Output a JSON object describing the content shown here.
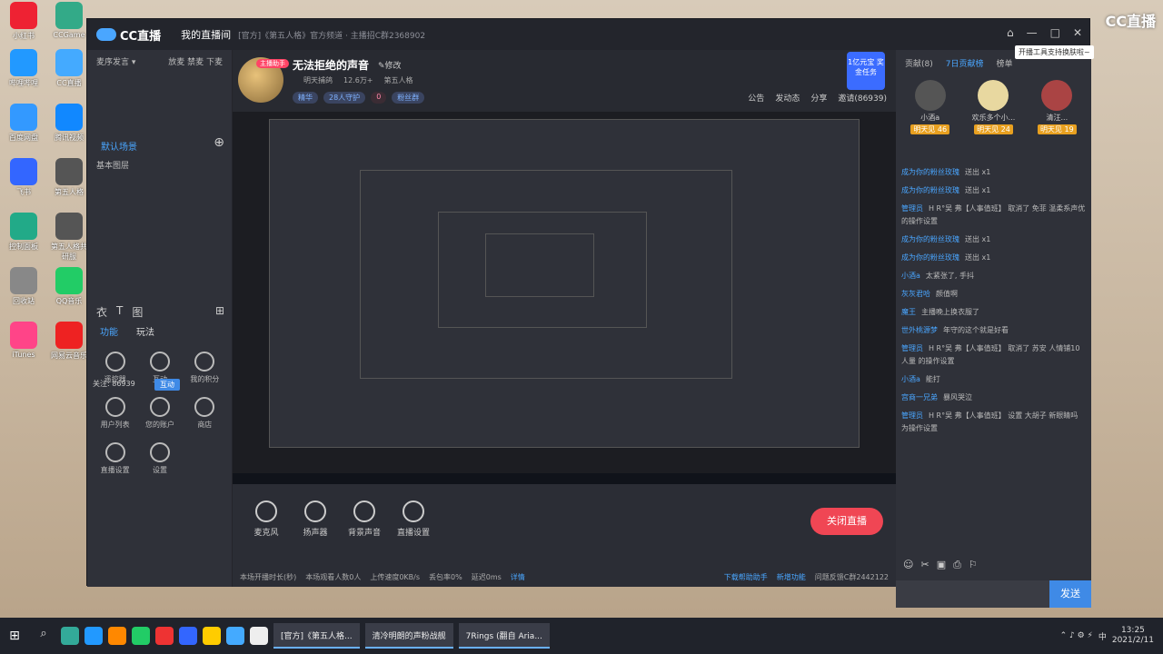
{
  "desktop_icons": [
    {
      "label": "小红书",
      "color": "#e23"
    },
    {
      "label": "CCGame",
      "color": "#3a8"
    },
    {
      "label": "哔哩哔哩",
      "color": "#29f"
    },
    {
      "label": "CC直播",
      "color": "#4af"
    },
    {
      "label": "百度网盘",
      "color": "#39f"
    },
    {
      "label": "腾讯视频",
      "color": "#18f"
    },
    {
      "label": "飞书",
      "color": "#36f"
    },
    {
      "label": "第五人格",
      "color": "#555"
    },
    {
      "label": "控制面板",
      "color": "#2a8"
    },
    {
      "label": "第五人格共研服",
      "color": "#555"
    },
    {
      "label": "回收站",
      "color": "#888"
    },
    {
      "label": "QQ音乐",
      "color": "#2c6"
    },
    {
      "label": "iTunes",
      "color": "#f48"
    },
    {
      "label": "网易云音乐",
      "color": "#e22"
    }
  ],
  "live_watermark": "CC直播",
  "window": {
    "logo": "CC直播",
    "tab_live": "我的直播间",
    "breadcrumb": "[官方]《第五人格》官方频道 · 主播招C群2368902",
    "controls": [
      "⌂",
      "—",
      "□",
      "✕"
    ]
  },
  "left_panel": {
    "header_left": "麦序发言 ▾",
    "header_right": "放麦 禁麦 下麦",
    "scene_title": "默认场景",
    "scene_add": "⊕",
    "scene_item": "基本图层",
    "tools": [
      "衣",
      "T",
      "图"
    ],
    "tool_add": "⊞",
    "func_tabs": [
      "功能",
      "玩法"
    ],
    "funcs": [
      "遥控器",
      "互动",
      "我的积分",
      "用户列表",
      "您的账户",
      "商店",
      "直播设置",
      "设置"
    ],
    "follow_text": "关注: 86939",
    "hud_label": "互动"
  },
  "room": {
    "helper_badge": "主播助手",
    "title": "无法拒绝的声音",
    "edit": "✎修改",
    "meta": [
      "明天捕鸽",
      "12.6万+",
      "第五人格"
    ],
    "chips": [
      "精华",
      "28人守护",
      "0",
      "粉丝群"
    ],
    "actions": [
      "公告",
      "发动态",
      "分享",
      "邀请(86939)"
    ],
    "promo": "1亿元宝 奖金任务"
  },
  "controls": {
    "buttons": [
      "麦克风",
      "扬声器",
      "背景声音",
      "直播设置"
    ],
    "stop_live": "关闭直播"
  },
  "status": {
    "items": [
      "本场开播时长(秒)",
      "本场观看人数0人",
      "上传速度0KB/s",
      "丢包率0%",
      "延迟0ms",
      "详情"
    ],
    "links": [
      "下载帮助助手",
      "新增功能",
      "问题反馈C群2442122"
    ]
  },
  "right_panel": {
    "tabs": [
      "贡献(8)",
      "7日贡献榜",
      "榜单"
    ],
    "ranks": [
      {
        "name": "小酒a",
        "badge": "明天见 46"
      },
      {
        "name": "欢乐多个小...",
        "badge": "明天见 24"
      },
      {
        "name": "清汪...",
        "badge": "明天见 19"
      }
    ],
    "chat": [
      {
        "user": "成为你的粉丝玫瑰",
        "text": "送出 x1"
      },
      {
        "user": "成为你的粉丝玫瑰",
        "text": "送出 x1"
      },
      {
        "user": "管理员",
        "text": "H R°吴 弗【人事值班】 取消了 免菲 温柔系声优 的操作设置"
      },
      {
        "user": "成为你的粉丝玫瑰",
        "text": "送出 x1"
      },
      {
        "user": "成为你的粉丝玫瑰",
        "text": "送出 x1"
      },
      {
        "user": "小酒a",
        "text": "太紧张了, 手抖"
      },
      {
        "user": "灰灰君哈",
        "text": "颜值啊"
      },
      {
        "user": "魔王",
        "text": "主播晚上换衣服了"
      },
      {
        "user": "世外桃源梦",
        "text": "年守的这个就是好看"
      },
      {
        "user": "管理员",
        "text": "H R°吴 弗【人事值班】 取消了 苏安 人情铺10人量 的操作设置"
      },
      {
        "user": "小酒a",
        "text": "能打"
      },
      {
        "user": "宫商一兄弟",
        "text": "暴风哭泣"
      },
      {
        "user": "管理员",
        "text": "H R°吴 弗【人事值班】 设置 大胡子 新眼睛吗 为操作设置"
      }
    ],
    "chat_tools": [
      "☺",
      "✂",
      "▣",
      "⎙",
      "⚐"
    ],
    "send": "发送"
  },
  "tooltip": "开播工具支持换肤啦~",
  "taskbar": {
    "start": "⊞",
    "apps": [
      "#3a9",
      "#29f",
      "#f80",
      "#2c6",
      "#e33",
      "#36f",
      "#fc0",
      "#4af",
      "#eee"
    ],
    "tasks": [
      "[官方]《第五人格...",
      "清冷明朗的声粉战舰",
      "7Rings (翻自 Aria..."
    ],
    "ime": "中",
    "time": "13:25",
    "date": "2021/2/11"
  },
  "colors": {
    "accent": "#4aa6ff",
    "stop": "#f04654",
    "panel": "#2f3139"
  }
}
